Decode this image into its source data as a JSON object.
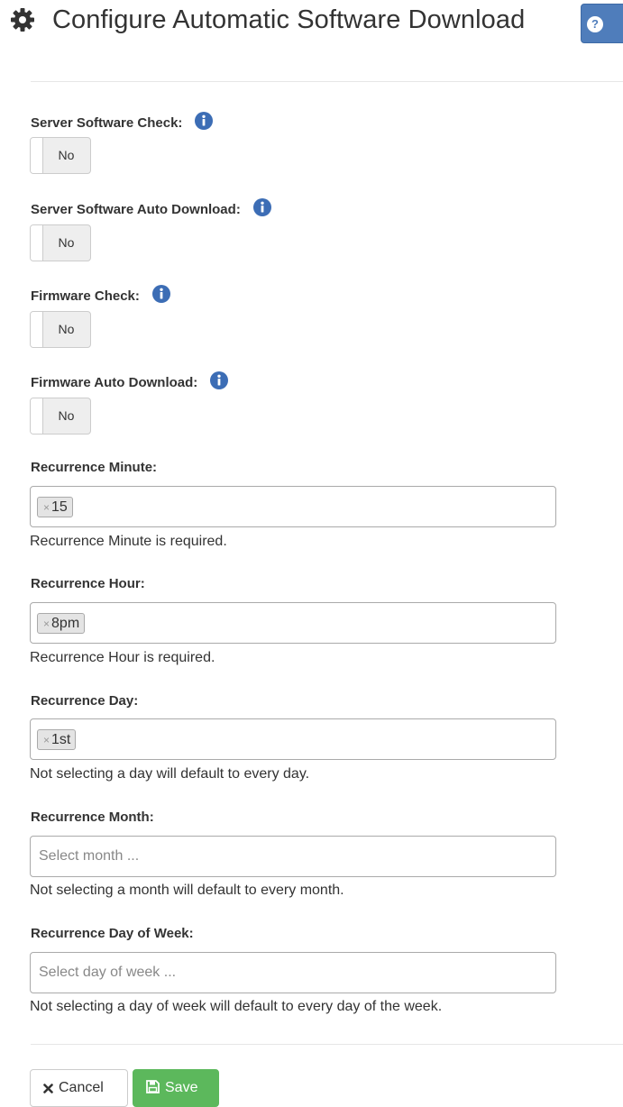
{
  "header": {
    "title": "Configure Automatic Software Download",
    "gear_icon": "gear-icon",
    "help_icon": "question-circle-icon",
    "help_color": "#4f7dbb"
  },
  "toggles": [
    {
      "label": "Server Software Check:",
      "value": "No"
    },
    {
      "label": "Server Software Auto Download:",
      "value": "No"
    },
    {
      "label": "Firmware Check:",
      "value": "No"
    },
    {
      "label": "Firmware Auto Download:",
      "value": "No"
    }
  ],
  "recurrence_minute": {
    "label": "Recurrence Minute:",
    "selected": "15",
    "help": "Recurrence Minute is required."
  },
  "recurrence_hour": {
    "label": "Recurrence Hour:",
    "selected": "8pm",
    "help": "Recurrence Hour is required."
  },
  "recurrence_day": {
    "label": "Recurrence Day:",
    "selected": "1st",
    "help": "Not selecting a day will default to every day."
  },
  "recurrence_month": {
    "label": "Recurrence Month:",
    "placeholder": "Select month ...",
    "help": "Not selecting a month will default to every month."
  },
  "recurrence_dow": {
    "label": "Recurrence Day of Week:",
    "placeholder": "Select day of week ...",
    "help": "Not selecting a day of week will default to every day of the week."
  },
  "chip_remove_glyph": "×",
  "info_icon_color": "#3c6db5",
  "buttons": {
    "cancel_label": "Cancel",
    "save_label": "Save",
    "save_color": "#5cb85c"
  }
}
